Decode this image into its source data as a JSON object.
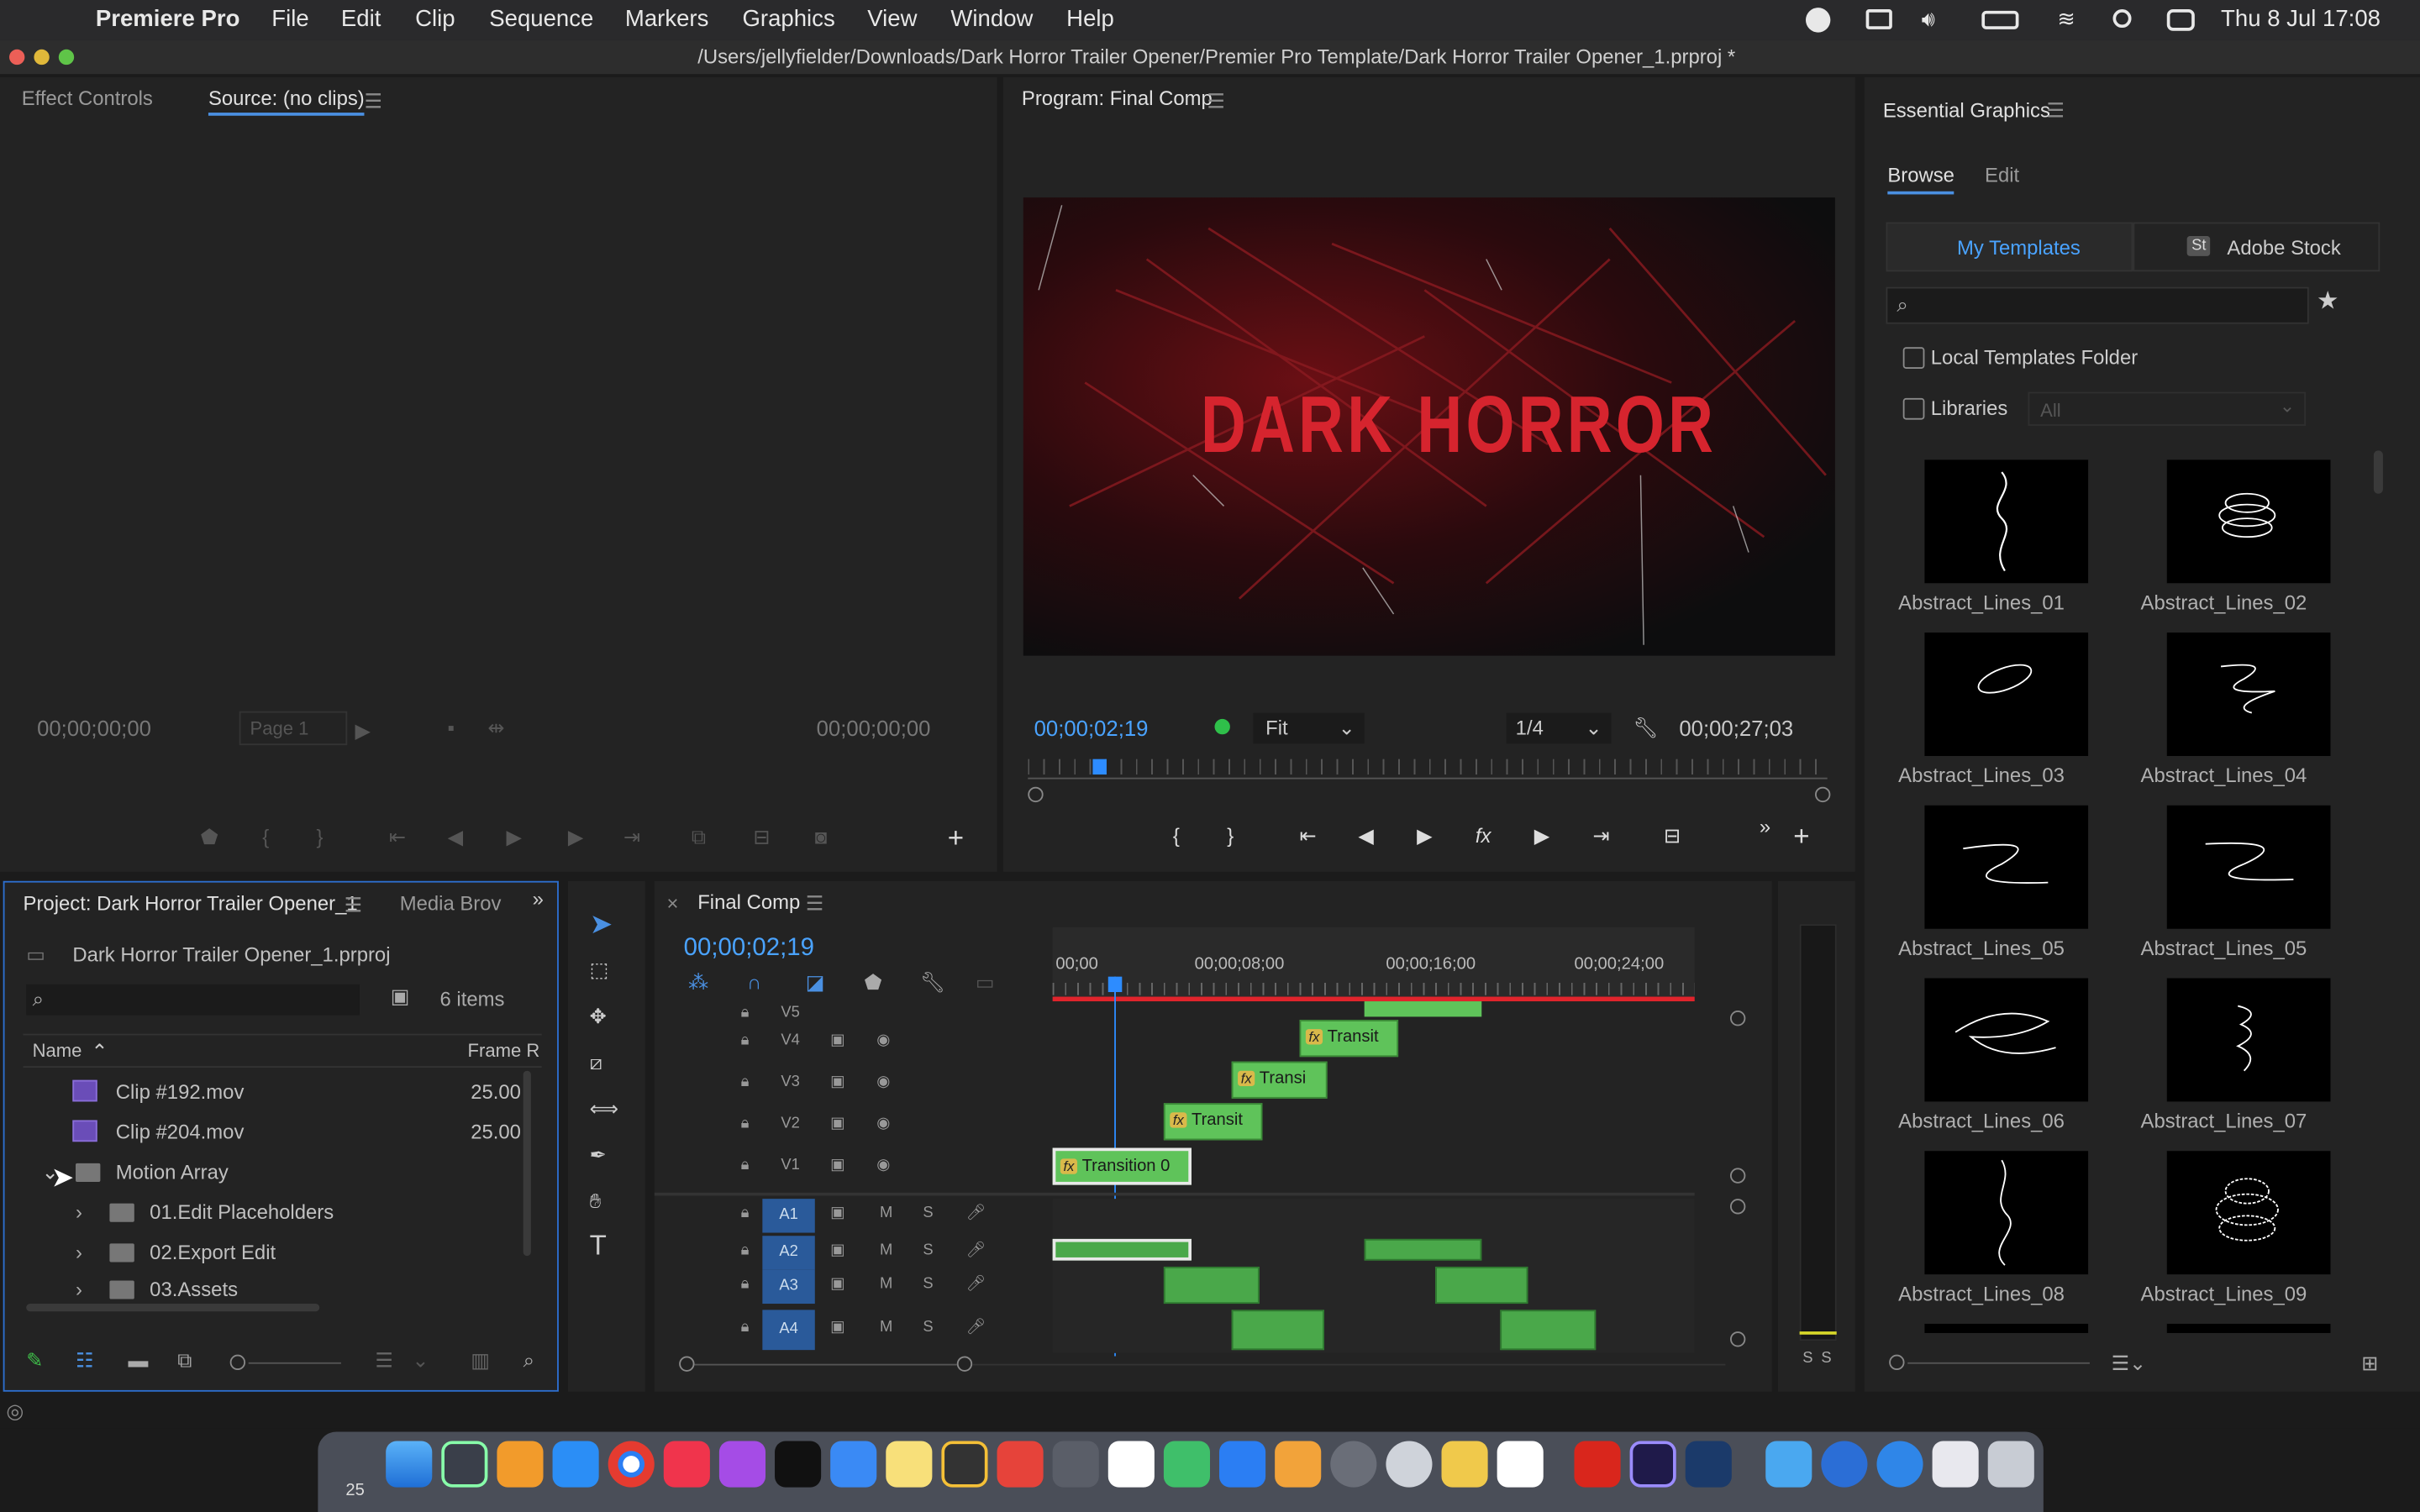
{
  "menubar": {
    "apple": "",
    "app": "Premiere Pro",
    "items": [
      "File",
      "Edit",
      "Clip",
      "Sequence",
      "Markers",
      "Graphics",
      "View",
      "Window",
      "Help"
    ],
    "datetime": "Thu 8 Jul  17:08"
  },
  "window": {
    "title": "/Users/jellyfielder/Downloads/Dark Horror Trailer Opener/Premier Pro Template/Dark Horror Trailer Opener_1.prproj *"
  },
  "source_panel": {
    "tab_effect_controls": "Effect Controls",
    "tab_source": "Source: (no clips)",
    "timecode_in": "00;00;00;00",
    "timecode_out": "00;00;00;00",
    "page": "Page 1"
  },
  "program_panel": {
    "title": "Program: Final Comp",
    "preview_text": "DARK HORROR",
    "timecode": "00;00;02;19",
    "fit": "Fit",
    "resolution": "1/4",
    "duration": "00;00;27;03"
  },
  "essential_graphics": {
    "title": "Essential Graphics",
    "tab_browse": "Browse",
    "tab_edit": "Edit",
    "my_templates": "My Templates",
    "adobe_stock": "Adobe Stock",
    "stock_badge": "St",
    "local_folder": "Local Templates Folder",
    "libraries": "Libraries",
    "libraries_select": "All",
    "templates": [
      {
        "name": "Abstract_Lines_01"
      },
      {
        "name": "Abstract_Lines_02"
      },
      {
        "name": "Abstract_Lines_03"
      },
      {
        "name": "Abstract_Lines_04"
      },
      {
        "name": "Abstract_Lines_05"
      },
      {
        "name": "Abstract_Lines_05"
      },
      {
        "name": "Abstract_Lines_06"
      },
      {
        "name": "Abstract_Lines_07"
      },
      {
        "name": "Abstract_Lines_08"
      },
      {
        "name": "Abstract_Lines_09"
      }
    ]
  },
  "project_panel": {
    "tab_project": "Project: Dark Horror Trailer Opener_1",
    "tab_media": "Media Brov",
    "file": "Dark Horror Trailer Opener_1.prproj",
    "items_count": "6 items",
    "col_name": "Name",
    "col_frame": "Frame R",
    "rows": [
      {
        "name": "Clip #192.mov",
        "rate": "25.00"
      },
      {
        "name": "Clip #204.mov",
        "rate": "25.00"
      },
      {
        "name": "Motion Array",
        "rate": ""
      },
      {
        "name": "01.Edit Placeholders",
        "rate": ""
      },
      {
        "name": "02.Export Edit",
        "rate": ""
      },
      {
        "name": "03.Assets",
        "rate": ""
      }
    ]
  },
  "timeline": {
    "tab": "Final Comp",
    "timecode": "00;00;02;19",
    "ruler": [
      "00;00",
      "00;00;08;00",
      "00;00;16;00",
      "00;00;24;00"
    ],
    "video_tracks": [
      "V5",
      "V4",
      "V3",
      "V2",
      "V1"
    ],
    "audio_tracks": [
      "A1",
      "A2",
      "A3",
      "A4"
    ],
    "clips": {
      "v4": "Transit",
      "v3": "Transi",
      "v2": "Transit",
      "v1": "Transition 0"
    },
    "fx": "fx",
    "m": "M",
    "s": "S",
    "meter_s": "S"
  },
  "dock": {
    "badge": "25"
  }
}
